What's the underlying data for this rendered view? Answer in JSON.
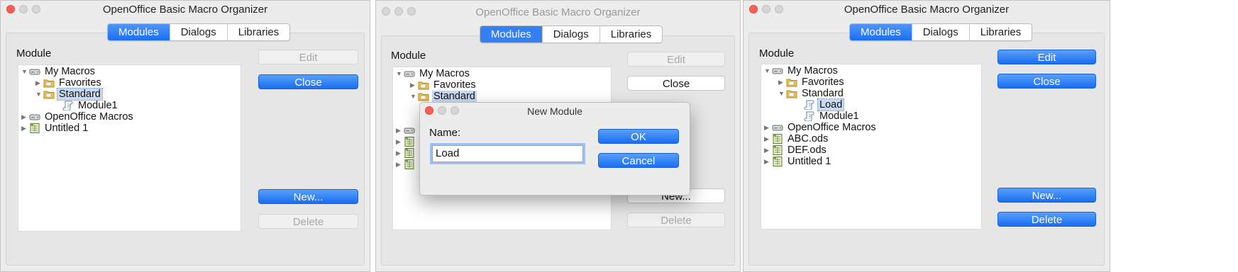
{
  "common": {
    "window_title": "OpenOffice Basic Macro Organizer",
    "tabs": [
      "Modules",
      "Dialogs",
      "Libraries"
    ],
    "module_label": "Module",
    "edit_label": "Edit",
    "close_label": "Close",
    "new_label": "New...",
    "delete_label": "Delete"
  },
  "window1": {
    "tree": [
      "My Macros",
      "Favorites",
      "Standard",
      "Module1",
      "OpenOffice Macros",
      "Untitled 1"
    ]
  },
  "window2": {
    "tree": [
      "My Macros",
      "Favorites",
      "Standard"
    ],
    "new_partial": "New...",
    "dialog": {
      "title": "New Module",
      "name_label": "Name:",
      "name_value": "Load",
      "ok_label": "OK",
      "cancel_label": "Cancel"
    }
  },
  "window3": {
    "tree": [
      "My Macros",
      "Favorites",
      "Standard",
      "Load",
      "Module1",
      "OpenOffice Macros",
      "ABC.ods",
      "DEF.ods",
      "Untitled 1"
    ]
  },
  "colors": {
    "accent": "#2e7cf6",
    "selection": "#c7d9f3",
    "close_light": "#fc5f57"
  }
}
